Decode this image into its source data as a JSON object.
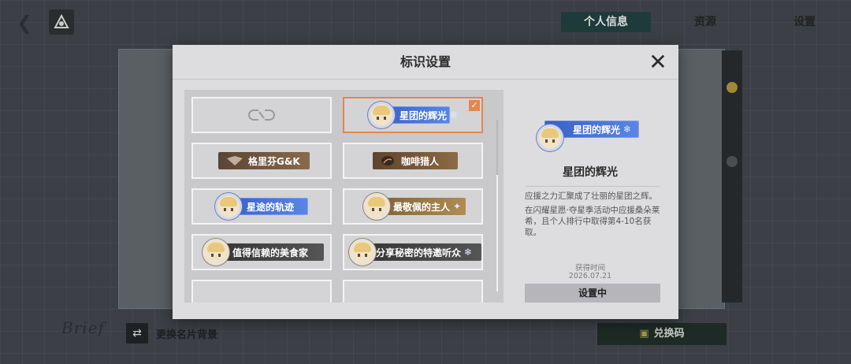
{
  "top_bar": {
    "back_icon": "back-arrow-icon",
    "logo_icon": "gfl-logo-icon",
    "tabs": [
      {
        "label": "个人信息",
        "active": true
      },
      {
        "label": "资源",
        "active": false
      },
      {
        "label": "设置",
        "active": false
      }
    ]
  },
  "background": {
    "brief_logo": "Brief",
    "swap_icon": "swap-arrows-icon",
    "swap_label": "更换名片背景",
    "redeem_icon": "gift-icon",
    "redeem_label": "兑换码"
  },
  "modal": {
    "title": "标识设置",
    "close_icon": "close-icon",
    "badges": [
      {
        "name": "none",
        "label": "",
        "style": "empty",
        "icon": "unlink-icon",
        "selected": false
      },
      {
        "name": "star-glow",
        "label": "星团的辉光",
        "style": "blue",
        "icon": "chibi-portrait-icon",
        "selected": true
      },
      {
        "name": "griffin",
        "label": "格里芬G&K",
        "style": "bronze",
        "icon": "griffin-emblem-icon",
        "selected": false
      },
      {
        "name": "coffee-hunter",
        "label": "咖啡猎人",
        "style": "brown",
        "icon": "coffee-bean-icon",
        "selected": false
      },
      {
        "name": "star-trail",
        "label": "星途的轨迹",
        "style": "blue",
        "icon": "chibi-portrait-icon",
        "selected": false
      },
      {
        "name": "respected-master",
        "label": "最敬佩的主人",
        "style": "gold",
        "icon": "chibi-portrait-icon",
        "selected": false
      },
      {
        "name": "trusted-gourmet",
        "label": "值得信赖的美食家",
        "style": "dark",
        "icon": "chibi-portrait-icon",
        "selected": false
      },
      {
        "name": "secret-guest",
        "label": "分享秘密的特邀听众",
        "style": "dark",
        "icon": "chibi-portrait-icon",
        "selected": false
      }
    ],
    "detail": {
      "badge_label": "星团的辉光",
      "name": "星团的辉光",
      "description_1": "应援之力汇聚成了壮丽的星团之辉。",
      "description_2": "在闪耀星愿·夺星季活动中应援桑朵莱希，且个人排行中取得第4-10名获取。",
      "obtain_label": "获得时间",
      "obtain_date": "2026.07.21",
      "button_label": "设置中"
    },
    "colors": {
      "selected_border": "#e38650",
      "badge_blue": "#3760c8",
      "panel_bg": "#dddde0"
    }
  }
}
